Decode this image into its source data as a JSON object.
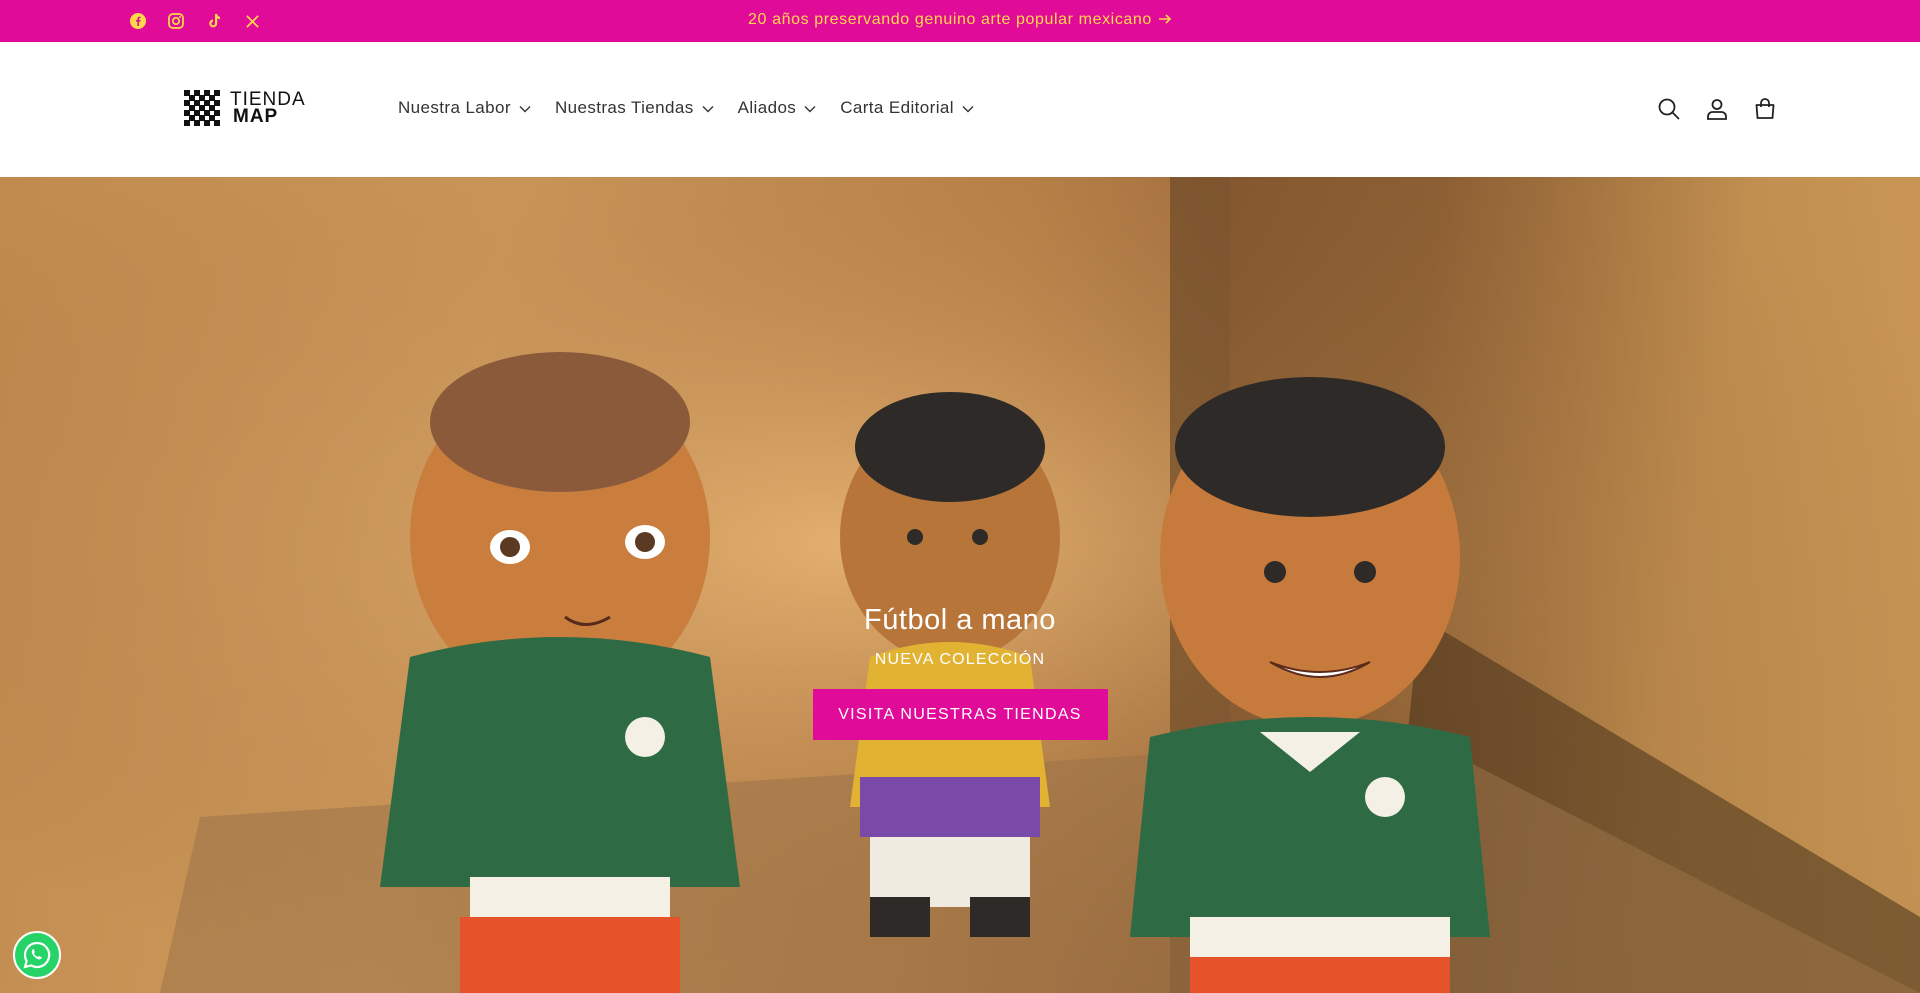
{
  "announcement": {
    "social_icons": [
      "facebook-icon",
      "instagram-icon",
      "tiktok-icon",
      "x-icon"
    ],
    "message": "20 años preservando genuino arte popular mexicano",
    "bg_color": "#e10b9a",
    "text_color": "#ffd84a"
  },
  "header": {
    "logo": {
      "line1": "TIENDA",
      "line2": "MAP"
    },
    "nav": [
      {
        "label": "Nuestra Labor"
      },
      {
        "label": "Nuestras Tiendas"
      },
      {
        "label": "Aliados"
      },
      {
        "label": "Carta Editorial"
      }
    ],
    "icons": [
      "search-icon",
      "account-icon",
      "cart-icon"
    ]
  },
  "hero": {
    "title": "Fútbol a mano",
    "subtitle": "NUEVA COLECCIÓN",
    "button_label": "VISITA NUESTRAS TIENDAS",
    "accent_color": "#e10b9a"
  },
  "floating": {
    "whatsapp_icon": "whatsapp-icon"
  }
}
